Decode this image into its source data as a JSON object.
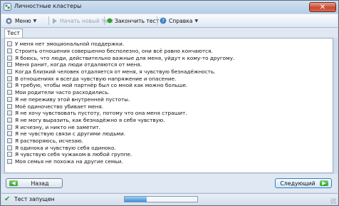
{
  "window": {
    "title": "Личностные кластеры",
    "close_label": "✕"
  },
  "toolbar": {
    "menu_label": "Меню",
    "new_test_label": "Начать новый тест",
    "finish_test_label": "Закончить тест",
    "help_label": "Справка"
  },
  "tabs": [
    {
      "label": "Тест",
      "active": true
    }
  ],
  "items": [
    "У меня нет эмоциональной поддержки.",
    "Строить отношения совершенно бесполезно, они всё равно кончаются.",
    "Я боюсь, что люди, действительно важные для меня, уйдут к кому-то другому.",
    "Меня ранит, когда люди отдаляются от меня.",
    "Когда близкий человек отдаляется от меня, я чувствую безнадёжность.",
    "В отношениях я всегда чувствую напряжение и опасение.",
    "Я требую, чтобы мой партнёр был со мной как можно больше.",
    "Мои родители часто расходились.",
    "Я не переживу этой внутренней пустоты.",
    "Моё одиночество убивает меня.",
    "Я не хочу чувствовать пустоту, потому что она меня страшит.",
    "Я не могу выразить, как безнадёжно я себя чувствую.",
    "Я исчезну, и никто не заметит.",
    "Я не чувствую связи с другими людьми.",
    "Я растворяюсь, исчезаю.",
    "Я одинока и чувствую себя одиноко.",
    "Я чувствую себя чужаком в любой группе.",
    "Моя семья не похожа на другие семьи."
  ],
  "buttons": {
    "back_label": "Назад",
    "next_label": "Следующий"
  },
  "status": {
    "text": "Тест запущен",
    "progress_fraction": 0.3
  },
  "colors": {
    "accent_green": "#2f9f2a",
    "progress_blue": "#3c8fd6",
    "close_red": "#c84a32"
  }
}
